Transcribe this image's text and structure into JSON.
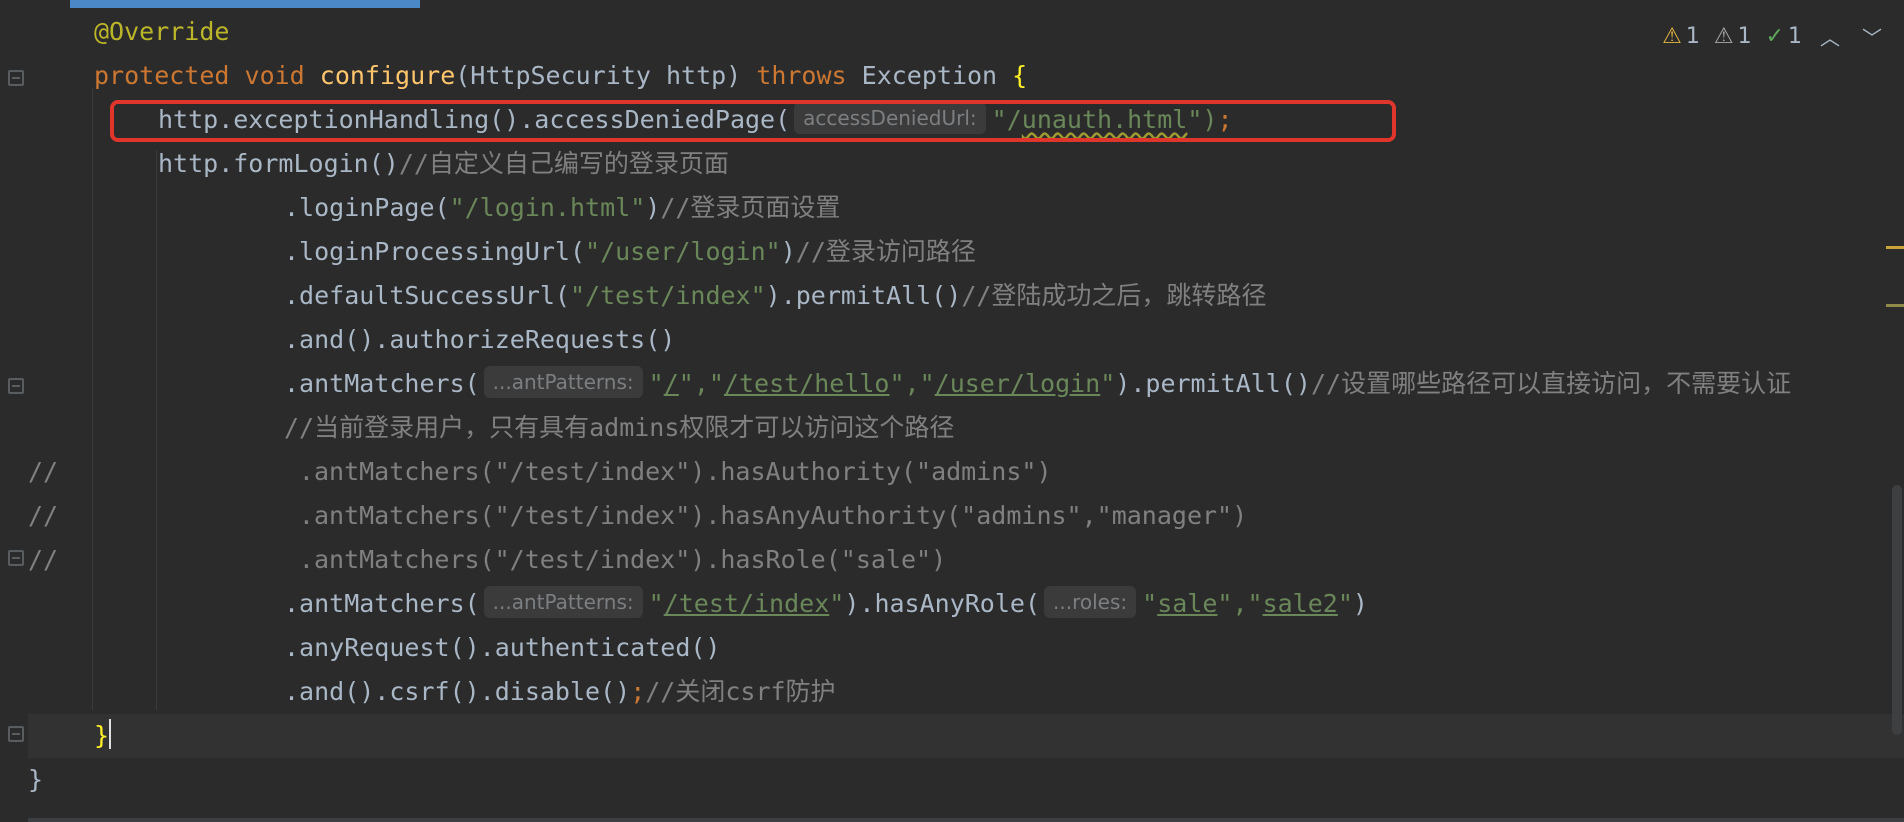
{
  "editor": {
    "lines": [
      {
        "tokens": [
          {
            "t": "@Override",
            "c": "ann"
          }
        ]
      },
      {
        "tokens": [
          {
            "t": "protected ",
            "c": "kw"
          },
          {
            "t": "void ",
            "c": "kw"
          },
          {
            "t": "configure",
            "c": "fn"
          },
          {
            "t": "(HttpSecurity http) ",
            "c": ""
          },
          {
            "t": "throws ",
            "c": "kw"
          },
          {
            "t": "Exception ",
            "c": ""
          },
          {
            "t": "{",
            "c": "brace"
          }
        ]
      },
      {
        "tokens": [
          {
            "t": "http.exceptionHandling().accessDeniedPage(",
            "c": ""
          },
          {
            "hint": "accessDeniedUrl:"
          },
          {
            "t": "\"/",
            "c": "str"
          },
          {
            "t": "unauth.html",
            "c": "str squiggle"
          },
          {
            "t": "\")",
            "c": "str"
          },
          {
            "t": ";",
            "c": "kw"
          }
        ]
      },
      {
        "tokens": [
          {
            "t": "http.formLogin()",
            "c": ""
          },
          {
            "t": "//自定义自己编写的登录页面",
            "c": "cmt"
          }
        ]
      },
      {
        "tokens": [
          {
            "t": ".loginPage(",
            "c": ""
          },
          {
            "t": "\"/login.html\"",
            "c": "str"
          },
          {
            "t": ")",
            "c": ""
          },
          {
            "t": "//登录页面设置",
            "c": "cmt"
          }
        ]
      },
      {
        "tokens": [
          {
            "t": ".loginProcessingUrl(",
            "c": ""
          },
          {
            "t": "\"/user/login\"",
            "c": "str"
          },
          {
            "t": ")",
            "c": ""
          },
          {
            "t": "//登录访问路径",
            "c": "cmt"
          }
        ]
      },
      {
        "tokens": [
          {
            "t": ".defaultSuccessUrl(",
            "c": ""
          },
          {
            "t": "\"/test/index\"",
            "c": "str"
          },
          {
            "t": ").permitAll()",
            "c": ""
          },
          {
            "t": "//登陆成功之后，跳转路径",
            "c": "cmt"
          }
        ]
      },
      {
        "tokens": [
          {
            "t": ".and().authorizeRequests()",
            "c": ""
          }
        ]
      },
      {
        "tokens": [
          {
            "t": ".antMatchers(",
            "c": ""
          },
          {
            "hint": "...antPatterns:"
          },
          {
            "t": "\"",
            "c": "str"
          },
          {
            "t": "/",
            "c": "str-u"
          },
          {
            "t": "\",\"",
            "c": "str"
          },
          {
            "t": "/test/hello",
            "c": "str-u"
          },
          {
            "t": "\",\"",
            "c": "str"
          },
          {
            "t": "/user/login",
            "c": "str-u"
          },
          {
            "t": "\"",
            "c": "str"
          },
          {
            "t": ").permitAll()",
            "c": ""
          },
          {
            "t": "//设置哪些路径可以直接访问，不需要认证",
            "c": "cmt"
          }
        ]
      },
      {
        "tokens": [
          {
            "t": "//当前登录用户，只有具有admins权限才可以访问这个路径",
            "c": "cmt"
          }
        ]
      },
      {
        "tokens": [
          {
            "t": "//",
            "c": "cmt"
          },
          {
            "t": "                .antMatchers(\"/test/index\").hasAuthority(\"admins\")",
            "c": "cmt"
          }
        ]
      },
      {
        "tokens": [
          {
            "t": "//",
            "c": "cmt"
          },
          {
            "t": "                .antMatchers(\"/test/index\").hasAnyAuthority(\"admins\",\"manager\")",
            "c": "cmt"
          }
        ]
      },
      {
        "tokens": [
          {
            "t": "//",
            "c": "cmt"
          },
          {
            "t": "                .antMatchers(\"/test/index\").hasRole(\"sale\")",
            "c": "cmt"
          }
        ]
      },
      {
        "tokens": [
          {
            "t": ".antMatchers(",
            "c": ""
          },
          {
            "hint": "...antPatterns:"
          },
          {
            "t": "\"",
            "c": "str"
          },
          {
            "t": "/test/index",
            "c": "str-u"
          },
          {
            "t": "\"",
            "c": "str"
          },
          {
            "t": ").hasAnyRole(",
            "c": ""
          },
          {
            "hint": "...roles:"
          },
          {
            "t": "\"",
            "c": "str"
          },
          {
            "t": "sale",
            "c": "str-u"
          },
          {
            "t": "\",\"",
            "c": "str"
          },
          {
            "t": "sale2",
            "c": "str-u"
          },
          {
            "t": "\"",
            "c": "str"
          },
          {
            "t": ")",
            "c": ""
          }
        ]
      },
      {
        "tokens": [
          {
            "t": ".anyRequest().authenticated()",
            "c": ""
          }
        ]
      },
      {
        "tokens": [
          {
            "t": ".and().csrf().disable()",
            "c": ""
          },
          {
            "t": ";",
            "c": "kw"
          },
          {
            "t": "//关闭csrf防护",
            "c": "cmt"
          }
        ]
      },
      {
        "tokens": [
          {
            "t": "}",
            "c": "brace"
          }
        ],
        "caret": true,
        "current": true
      },
      {
        "tokens": [
          {
            "t": "}",
            "c": ""
          }
        ]
      }
    ]
  },
  "inspections": {
    "warnings": "1",
    "weak_warnings": "1",
    "typos": "1"
  }
}
